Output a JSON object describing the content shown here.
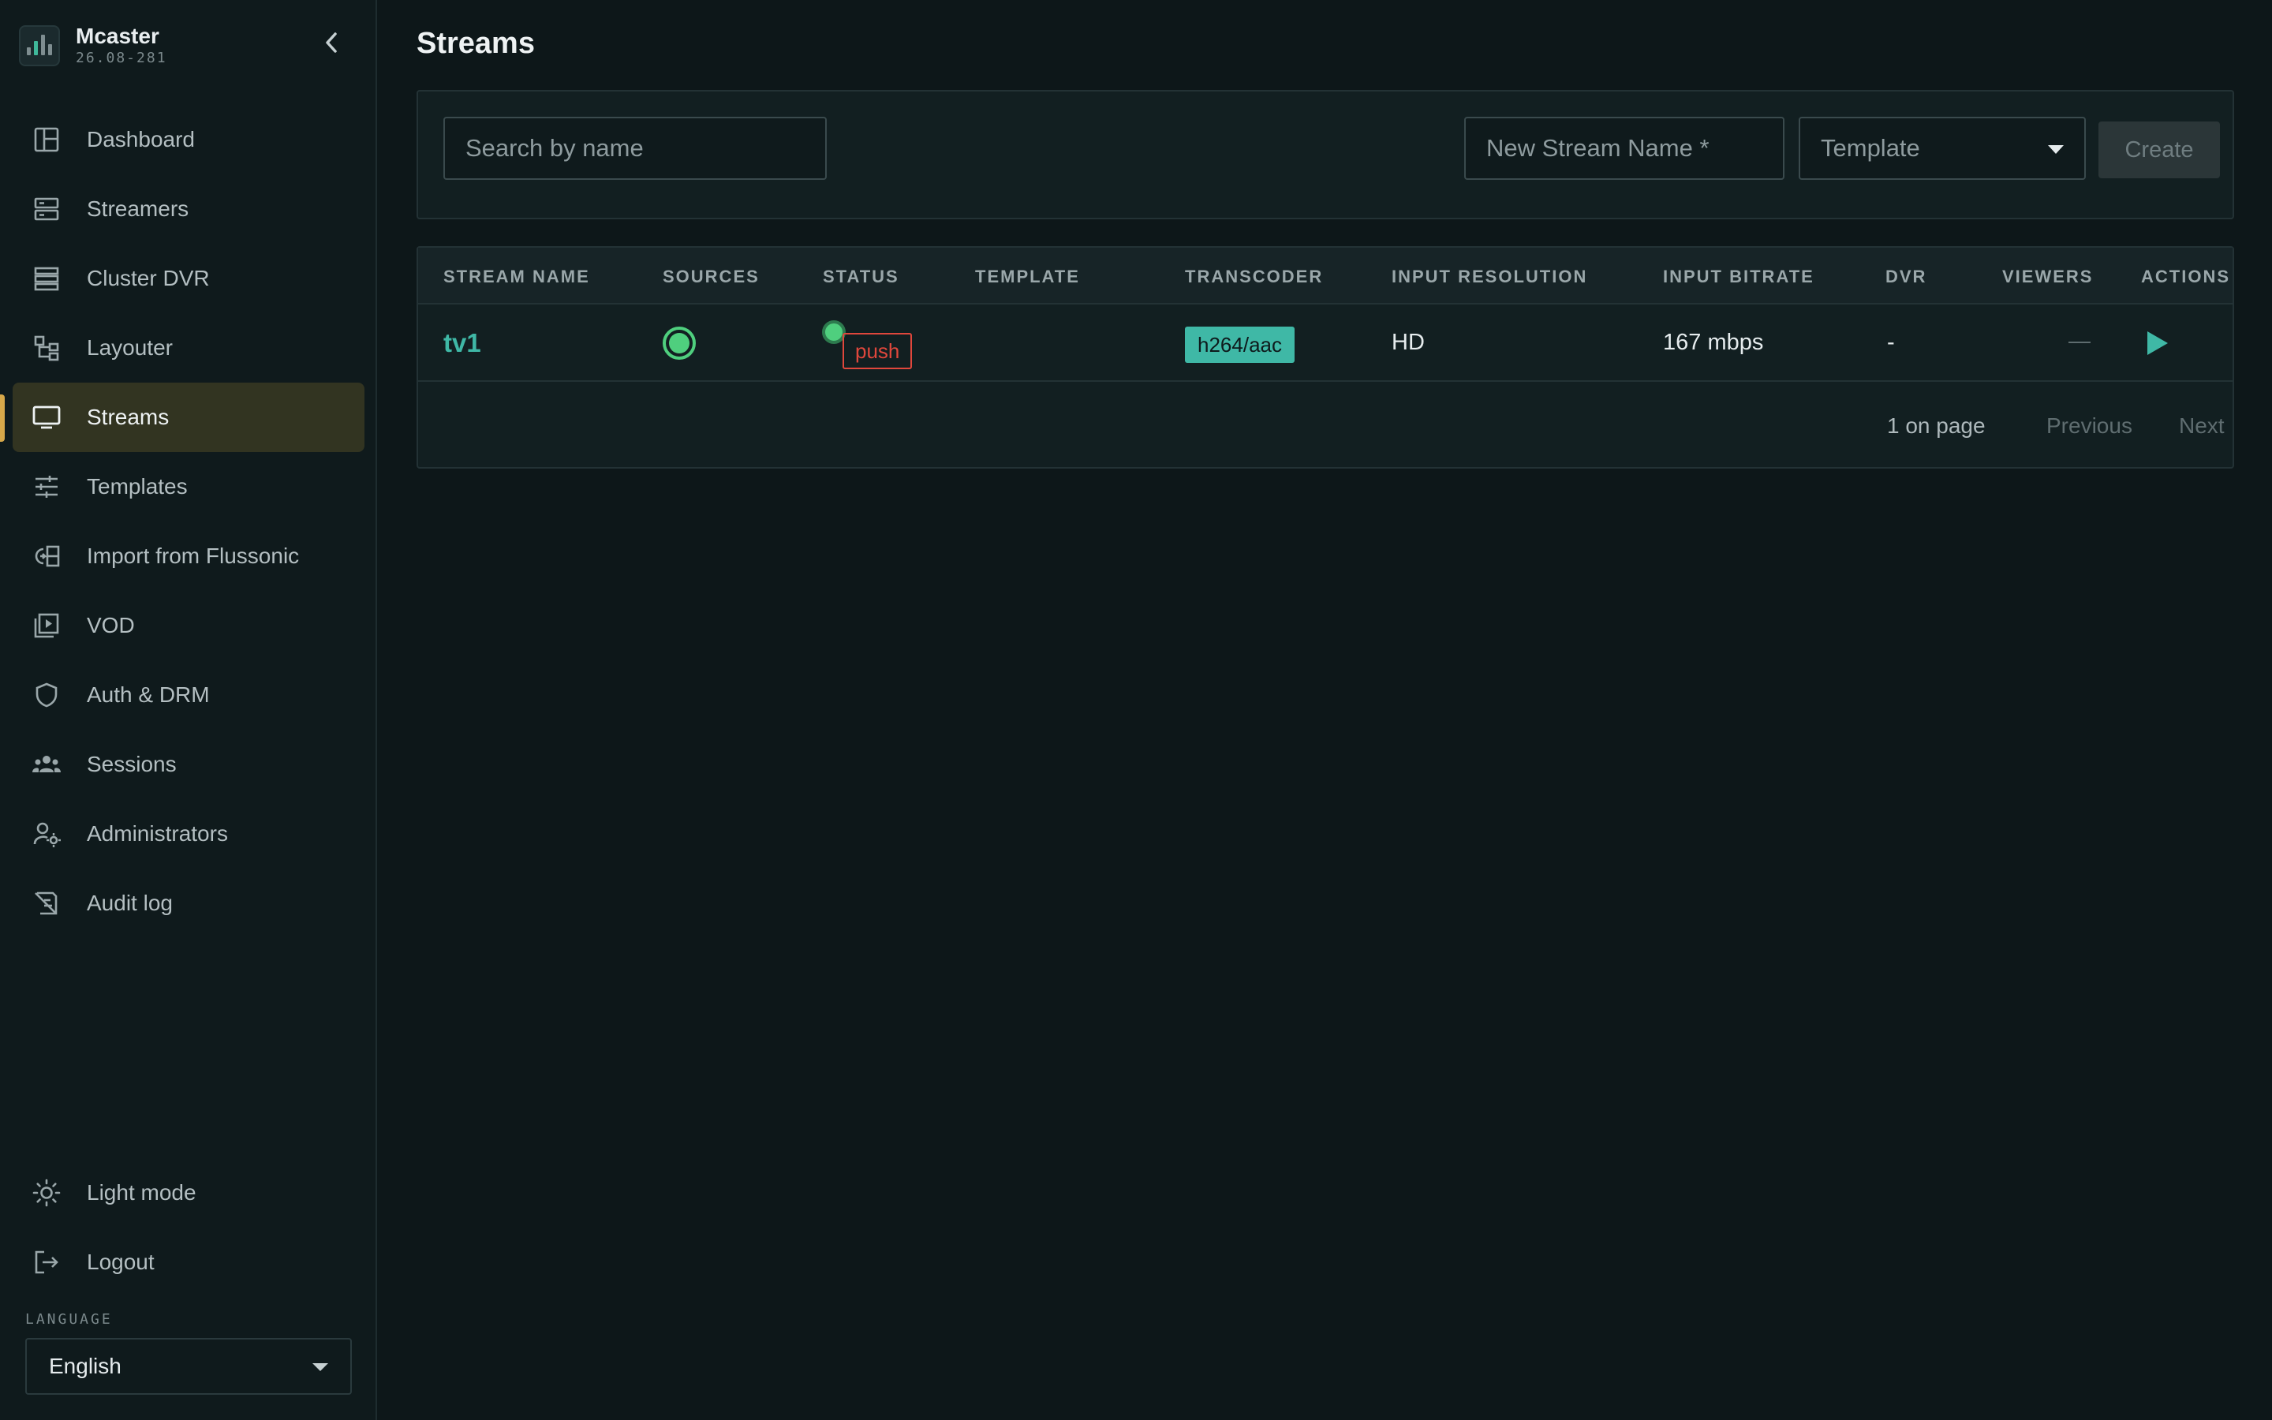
{
  "app": {
    "name": "Mcaster",
    "version": "26.08-281"
  },
  "sidebar": {
    "items": [
      {
        "label": "Dashboard",
        "icon": "dashboard-icon"
      },
      {
        "label": "Streamers",
        "icon": "streamers-icon"
      },
      {
        "label": "Cluster DVR",
        "icon": "cluster-dvr-icon"
      },
      {
        "label": "Layouter",
        "icon": "layouter-icon"
      },
      {
        "label": "Streams",
        "icon": "monitor-icon",
        "active": true
      },
      {
        "label": "Templates",
        "icon": "sliders-icon"
      },
      {
        "label": "Import from Flussonic",
        "icon": "import-icon"
      },
      {
        "label": "VOD",
        "icon": "vod-icon"
      },
      {
        "label": "Auth & DRM",
        "icon": "shield-icon"
      },
      {
        "label": "Sessions",
        "icon": "users-icon"
      },
      {
        "label": "Administrators",
        "icon": "admin-gear-icon"
      },
      {
        "label": "Audit log",
        "icon": "audit-log-icon"
      }
    ],
    "bottom": [
      {
        "label": "Light mode",
        "icon": "sun-icon"
      },
      {
        "label": "Logout",
        "icon": "logout-icon"
      }
    ],
    "language_label": "LANGUAGE",
    "language_value": "English"
  },
  "page": {
    "title": "Streams"
  },
  "toolbar": {
    "search_placeholder": "Search by name",
    "name_placeholder": "New Stream Name *",
    "template_value": "Template",
    "create_label": "Create"
  },
  "table": {
    "columns": [
      "STREAM NAME",
      "SOURCES",
      "STATUS",
      "TEMPLATE",
      "TRANSCODER",
      "INPUT RESOLUTION",
      "INPUT BITRATE",
      "DVR",
      "VIEWERS",
      "ACTIONS"
    ],
    "rows": [
      {
        "name": "tv1",
        "status_badge": "push",
        "template": "",
        "transcoder": "h264/aac",
        "resolution": "HD",
        "bitrate": "167 mbps",
        "dvr": "-"
      }
    ]
  },
  "pagination": {
    "count": "1 on page",
    "previous": "Previous",
    "next": "Next"
  },
  "colors": {
    "accent": "#3fb8a6",
    "active_marker": "#d7a84a",
    "status_green": "#4fcf7e",
    "push_red": "#e0473c"
  }
}
